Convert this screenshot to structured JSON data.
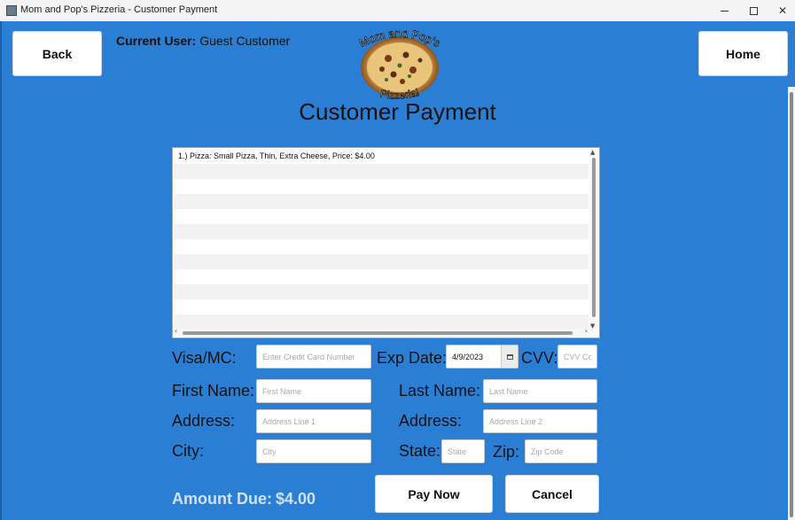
{
  "window": {
    "title": "Mom and Pop's Pizzeria - Customer Payment"
  },
  "nav": {
    "back_label": "Back",
    "home_label": "Home"
  },
  "user": {
    "label": "Current User:",
    "name": "Guest Customer"
  },
  "logo": {
    "line1": "Mom and Pop's",
    "line2": "Pizzeria!"
  },
  "page": {
    "title": "Customer Payment"
  },
  "order_items": [
    "1.) Pizza: Small Pizza, Thin, Extra Cheese,  Price: $4.00"
  ],
  "form": {
    "card_label": "Visa/MC:",
    "card_placeholder": "Enter Credit Card Number",
    "exp_label": "Exp Date:",
    "exp_value": "4/9/2023",
    "cvv_label": "CVV:",
    "cvv_placeholder": "CVV Code",
    "first_label": "First Name:",
    "first_placeholder": "First Name",
    "last_label": "Last Name:",
    "last_placeholder": "Last Name",
    "address1_label": "Address:",
    "address1_placeholder": "Address Line 1",
    "address2_label": "Address:",
    "address2_placeholder": "Address Line 2",
    "city_label": "City:",
    "city_placeholder": "City",
    "state_label": "State:",
    "state_placeholder": "State",
    "zip_label": "Zip:",
    "zip_placeholder": "Zip Code"
  },
  "amount": {
    "label": "Amount Due:",
    "value": "$4.00"
  },
  "actions": {
    "pay_label": "Pay Now",
    "cancel_label": "Cancel"
  },
  "colors": {
    "background": "#2a7fd4",
    "amount_text": "#cfe1f6"
  }
}
